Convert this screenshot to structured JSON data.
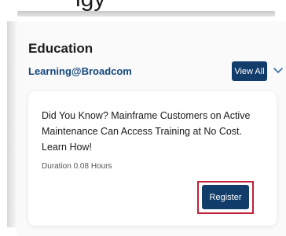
{
  "page_top_text": "igy",
  "section": {
    "title": "Education",
    "provider": "Learning@Broadcom",
    "view_all_label": "View All"
  },
  "card": {
    "title": "Did You Know? Mainframe Customers on Active Maintenance Can Access Training at No Cost. Learn How!",
    "duration": "Duration 0.08 Hours",
    "register_label": "Register"
  },
  "colors": {
    "button_bg": "#123d6b",
    "provider_text": "#14477d",
    "highlight_border": "#c0203a"
  },
  "icons": {
    "expand": "chevron-down-icon"
  }
}
